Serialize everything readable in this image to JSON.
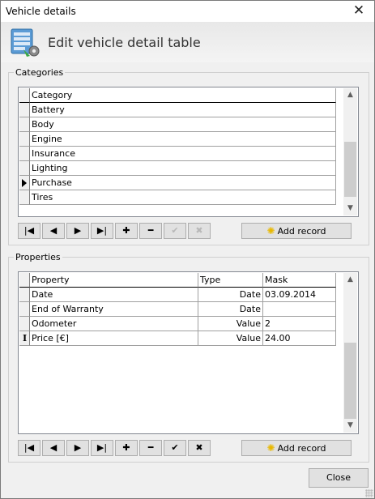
{
  "window": {
    "title": "Vehicle details",
    "close_glyph": "✕"
  },
  "header": {
    "title": "Edit vehicle detail table",
    "icon": "table-edit-icon"
  },
  "categories": {
    "legend": "Categories",
    "column_header": "Category",
    "rows": [
      "Battery",
      "Body",
      "Engine",
      "Insurance",
      "Lighting",
      "Purchase",
      "Tires"
    ],
    "current_row": "Purchase"
  },
  "properties": {
    "legend": "Properties",
    "columns": [
      "Property",
      "Type",
      "Mask"
    ],
    "rows": [
      {
        "property": "Date",
        "type": "Date",
        "mask": "03.09.2014"
      },
      {
        "property": "End of Warranty",
        "type": "Date",
        "mask": ""
      },
      {
        "property": "Odometer",
        "type": "Value",
        "mask": "2"
      },
      {
        "property": "Price [€]",
        "type": "Value",
        "mask": "24.00"
      }
    ],
    "editing_row": "Price [€]"
  },
  "navigator": {
    "first": "|◀",
    "prior": "◀",
    "next": "▶",
    "last": "▶|",
    "insert": "✚",
    "delete": "━",
    "post": "✔",
    "cancel": "✖"
  },
  "buttons": {
    "add_record": "Add record",
    "add_record_icon": "✺",
    "close": "Close"
  },
  "scroll": {
    "up": "▲",
    "down": "▼"
  }
}
